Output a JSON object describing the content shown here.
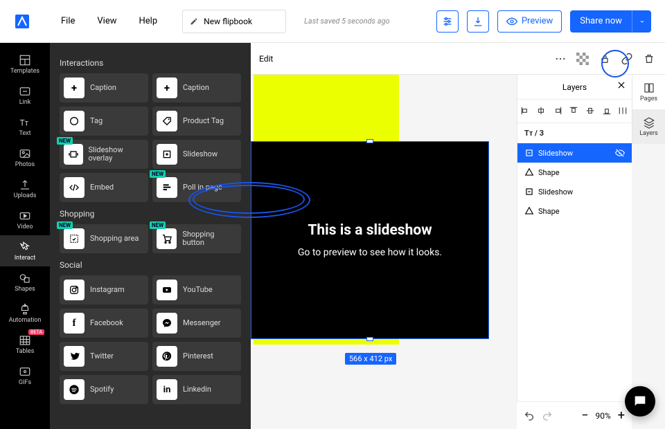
{
  "topbar": {
    "menu": [
      "File",
      "View",
      "Help"
    ],
    "title_value": "New flipbook",
    "saved": "Last saved 5 seconds ago",
    "preview_label": "Preview",
    "share_label": "Share now"
  },
  "rail": [
    {
      "label": "Templates",
      "name": "templates"
    },
    {
      "label": "Link",
      "name": "link"
    },
    {
      "label": "Text",
      "name": "text"
    },
    {
      "label": "Photos",
      "name": "photos"
    },
    {
      "label": "Uploads",
      "name": "uploads"
    },
    {
      "label": "Video",
      "name": "video"
    },
    {
      "label": "Interact",
      "name": "interact",
      "active": true
    },
    {
      "label": "Shapes",
      "name": "shapes"
    },
    {
      "label": "Automation",
      "name": "automation"
    },
    {
      "label": "Tables",
      "name": "tables",
      "beta": true
    },
    {
      "label": "GIFs",
      "name": "gifs"
    }
  ],
  "panel": {
    "sections": {
      "interactions": {
        "title": "Interactions",
        "items": [
          {
            "label": "Caption",
            "name": "caption"
          },
          {
            "label": "Caption",
            "name": "caption2"
          },
          {
            "label": "Tag",
            "name": "tag"
          },
          {
            "label": "Product Tag",
            "name": "product-tag"
          },
          {
            "label": "Slideshow overlay",
            "name": "slideshow-overlay",
            "new": true
          },
          {
            "label": "Slideshow",
            "name": "slideshow"
          },
          {
            "label": "Embed",
            "name": "embed"
          },
          {
            "label": "Poll in page",
            "name": "poll-in-page",
            "new": true
          }
        ]
      },
      "shopping": {
        "title": "Shopping",
        "items": [
          {
            "label": "Shopping area",
            "name": "shopping-area",
            "new": true
          },
          {
            "label": "Shopping button",
            "name": "shopping-button",
            "new": true
          }
        ]
      },
      "social": {
        "title": "Social",
        "items": [
          {
            "label": "Instagram",
            "name": "instagram"
          },
          {
            "label": "YouTube",
            "name": "youtube"
          },
          {
            "label": "Facebook",
            "name": "facebook"
          },
          {
            "label": "Messenger",
            "name": "messenger"
          },
          {
            "label": "Twitter",
            "name": "twitter"
          },
          {
            "label": "Pinterest",
            "name": "pinterest"
          },
          {
            "label": "Spotify",
            "name": "spotify"
          },
          {
            "label": "Linkedin",
            "name": "linkedin"
          }
        ]
      }
    }
  },
  "edit_strip": {
    "label": "Edit"
  },
  "canvas": {
    "slideshow_title": "This is a slideshow",
    "slideshow_sub": "Go to preview to see how it looks.",
    "dimensions": "566 x 412 px"
  },
  "right_rail": {
    "pages": "Pages",
    "layers": "Layers"
  },
  "layers_panel": {
    "title": "Layers",
    "count_prefix": "Tᴛ / ",
    "count": "3",
    "items": [
      {
        "label": "Slideshow",
        "selected": true,
        "icon": "slideshow"
      },
      {
        "label": "Shape",
        "icon": "shape"
      },
      {
        "label": "Slideshow",
        "icon": "slideshow"
      },
      {
        "label": "Shape",
        "icon": "shape"
      }
    ]
  },
  "zoom": {
    "value": "90%"
  },
  "badges": {
    "new": "NEW",
    "beta": "BETA"
  }
}
